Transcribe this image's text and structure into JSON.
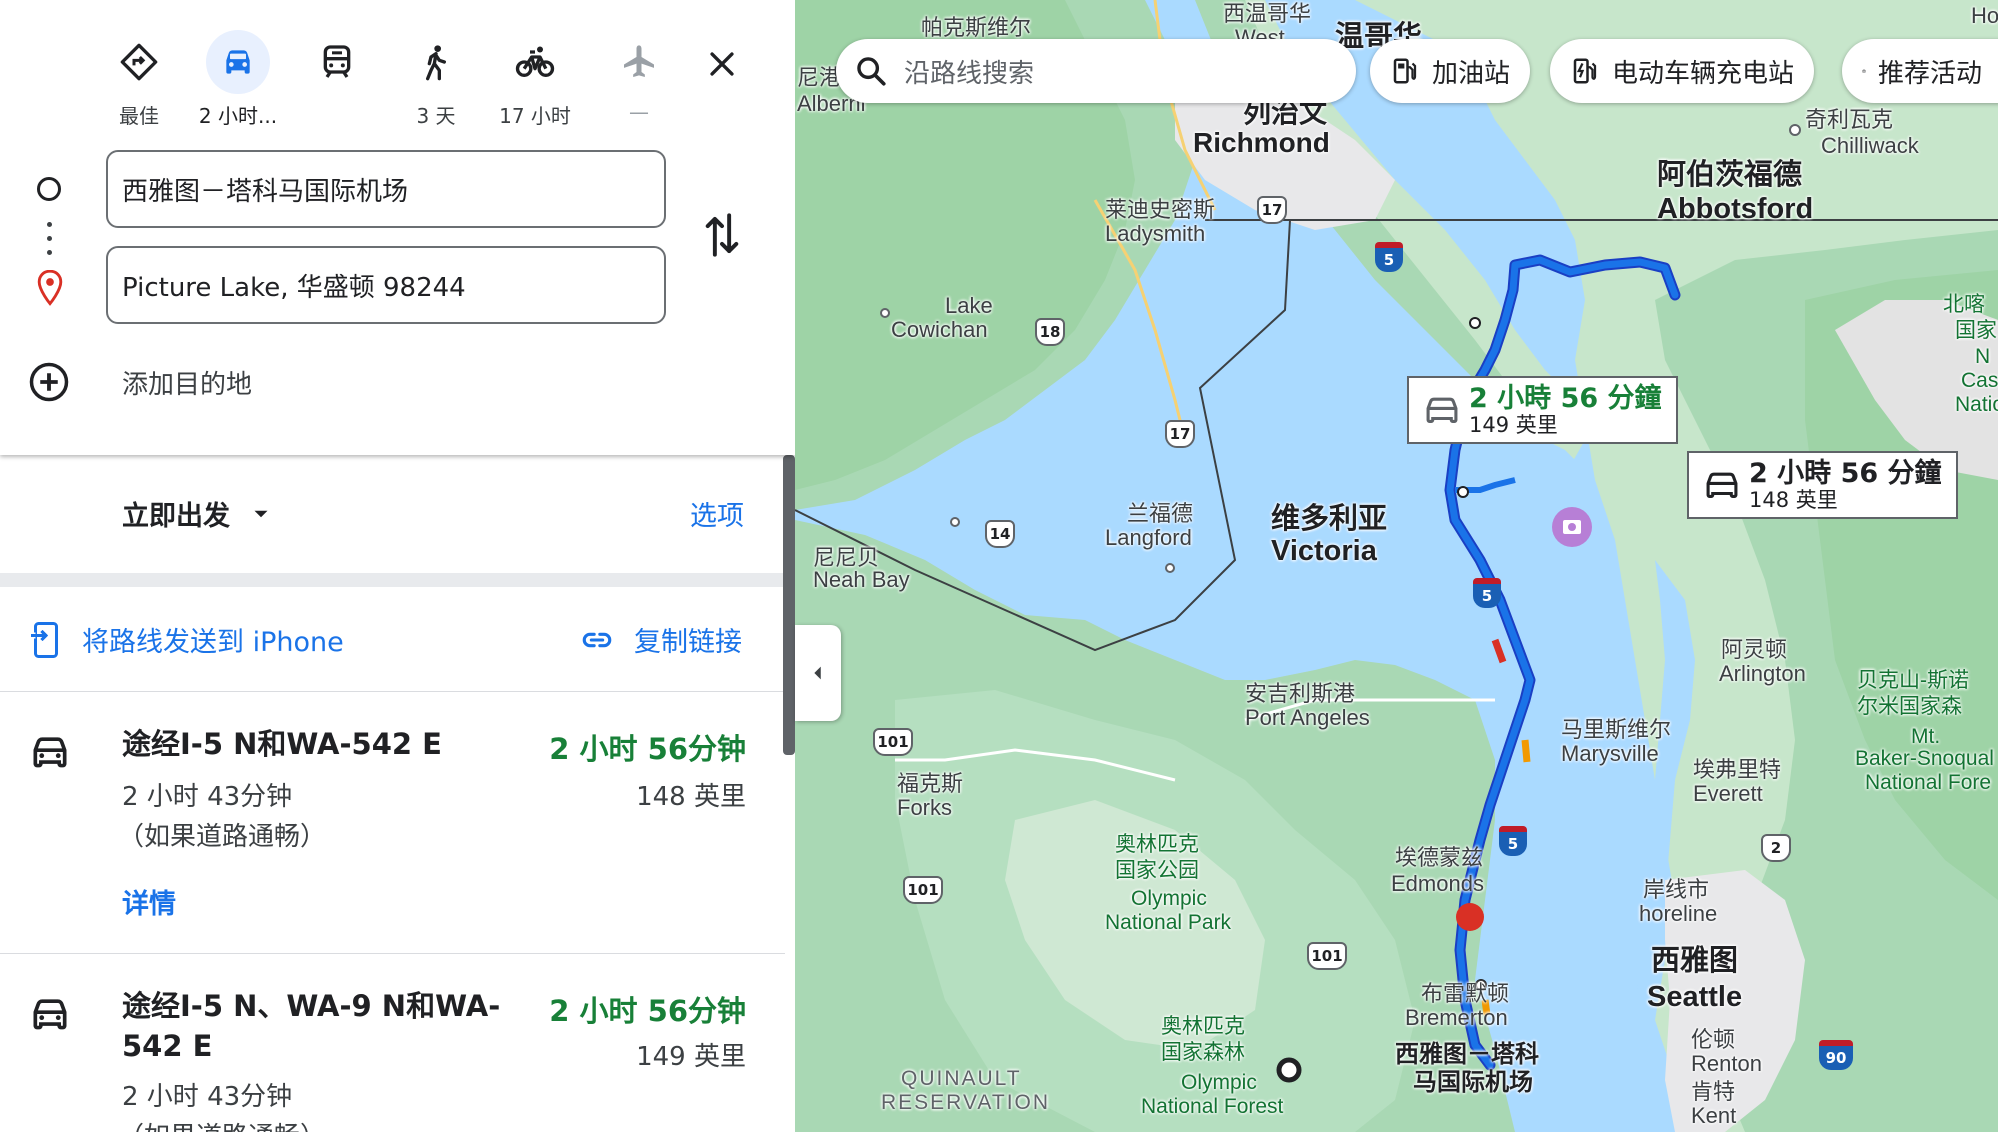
{
  "travel_modes": [
    {
      "label": "最佳",
      "icon": "best-route-icon"
    },
    {
      "label": "2 小时...",
      "icon": "car-icon",
      "selected": true
    },
    {
      "label": "",
      "icon": "train-icon"
    },
    {
      "label": "3 天",
      "icon": "walk-icon"
    },
    {
      "label": "17 小时",
      "icon": "bike-icon"
    },
    {
      "label": "—",
      "icon": "flight-icon"
    }
  ],
  "origin": "西雅图－塔科马国际机场",
  "destination": "Picture Lake, 华盛顿 98244",
  "add_destination": "添加目的地",
  "depart": "立即出发",
  "options": "选项",
  "send_to_phone": "将路线发送到 iPhone",
  "copy_link": "复制链接",
  "routes": [
    {
      "title": "途经I-5 N和WA-542 E",
      "duration": "2 小时 56分钟",
      "distance": "148 英里",
      "typical": "2 小时 43分钟",
      "typical_note": "（如果道路通畅）",
      "details": "详情"
    },
    {
      "title": "途经I-5 N、WA-9 N和WA-542 E",
      "duration": "2 小时 56分钟",
      "distance": "149 英里",
      "typical": "2 小时 43分钟",
      "typical_note": "（如果道路通畅）"
    }
  ],
  "map": {
    "search_placeholder": "沿路线搜索",
    "chips": [
      "加油站",
      "电动车辆充电站",
      "推荐活动"
    ],
    "callouts": [
      {
        "time": "2 小時 56 分鐘",
        "distance": "149 英里",
        "color": "#188038"
      },
      {
        "time": "2 小時 56 分鐘",
        "distance": "148 英里",
        "color": "#202124"
      }
    ],
    "labels": {
      "portmoody_cn": "帕克斯维尔",
      "west_cn": "西温哥华",
      "west_en": "West",
      "yvr_cn": "温哥华",
      "nanaimo_cn": "尼港",
      "nanaimo_en": "Alberni",
      "richmond_cn": "列治文",
      "richmond_en": "Richmond",
      "chilliwack_cn": "奇利瓦克",
      "chilliwack_en": "Chilliwack",
      "abbotsford_cn": "阿伯茨福德",
      "abbotsford_en": "Abbotsford",
      "ladysmith_cn": "莱迪史密斯",
      "ladysmith_en": "Ladysmith",
      "lakecow_en1": "Lake",
      "lakecow_en2": "Cowichan",
      "langford_cn": "兰福德",
      "langford_en": "Langford",
      "victoria_cn": "维多利亚",
      "victoria_en": "Victoria",
      "neah_cn": "尼尼贝",
      "neah_en": "Neah Bay",
      "portangeles_cn": "安吉利斯港",
      "portangeles_en": "Port Angeles",
      "arlington_cn": "阿灵顿",
      "arlington_en": "Arlington",
      "marysville_cn": "马里斯维尔",
      "marysville_en": "Marysville",
      "everett_cn": "埃弗里特",
      "everett_en": "Everett",
      "forks_cn": "福克斯",
      "forks_en": "Forks",
      "olympicnp_cn1": "奥林匹克",
      "olympicnp_cn2": "国家公园",
      "olympicnp_en1": "Olympic",
      "olympicnp_en2": "National Park",
      "edmonds_cn": "埃德蒙兹",
      "edmonds_en": "Edmonds",
      "shoreline_cn": "岸线市",
      "shoreline_en": "horeline",
      "seattle_cn": "西雅图",
      "seattle_en": "Seattle",
      "bremerton_cn": "布雷默顿",
      "bremerton_en": "Bremerton",
      "olympicnf_cn1": "奥林匹克",
      "olympicnf_cn2": "国家森林",
      "olympicnf_en1": "Olympic",
      "olympicnf_en2": "National Forest",
      "renton_cn": "伦顿",
      "renton_en": "Renton",
      "kent_cn": "肯特",
      "kent_en": "Kent",
      "seatac_cn1": "西雅图－塔科",
      "seatac_cn2": "马国际机场",
      "quinault1": "QUINAULT",
      "quinault2": "RESERVATION",
      "northcascades_cn1": "北喀",
      "northcascades_cn2": "国家",
      "northcascades_en1": "N",
      "northcascades_en2": "Cas",
      "northcascades_en3": "Natio",
      "baker_cn1": "贝克山-斯诺",
      "baker_cn2": "尔米国家森",
      "baker_en1": "Mt.",
      "baker_en2": "Baker-Snoqual",
      "baker_en3": "National Fore",
      "ho_en": "Ho"
    },
    "shields": {
      "bc17": "17",
      "bc18": "18",
      "bc17b": "17",
      "bc14": "14",
      "us101a": "101",
      "us101b": "101",
      "us101c": "101",
      "wa2": "2",
      "i5a": "5",
      "i5b": "5",
      "i5c": "5",
      "i90": "90"
    }
  }
}
